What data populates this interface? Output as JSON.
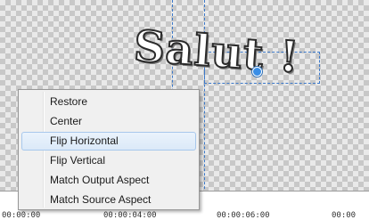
{
  "overlay_text": "Salut !",
  "context_menu": {
    "items": [
      {
        "label": "Restore"
      },
      {
        "label": "Center"
      },
      {
        "label": "Flip Horizontal",
        "highlighted": true
      },
      {
        "label": "Flip Vertical"
      },
      {
        "label": "Match Output Aspect"
      },
      {
        "label": "Match Source Aspect"
      }
    ]
  },
  "timeline": {
    "timecodes": [
      "00:00:00",
      "00:00:04:00",
      "00:00:06:00",
      "00:00"
    ]
  },
  "colors": {
    "guide": "#3b78c9",
    "handle": "#3a8ee6",
    "menu_bg": "#f0f0f0",
    "menu_highlight": "#dbe9f8"
  }
}
